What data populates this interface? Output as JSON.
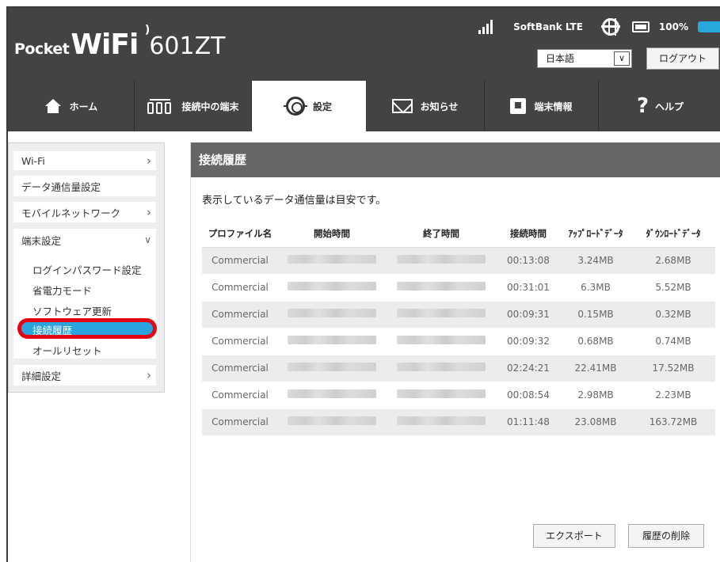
{
  "header": {
    "brand_pocket": "Pocket",
    "brand_wifi": "WiFi",
    "model": "601ZT",
    "carrier": "SoftBank  LTE",
    "battery": "100%",
    "language": "日本語",
    "logout_label": "ログアウト"
  },
  "nav": {
    "home": "ホーム",
    "connected_devices": "接続中の端末",
    "settings": "設定",
    "notices": "お知らせ",
    "device_info": "端末情報",
    "help": "ヘルプ"
  },
  "sidebar": {
    "wifi": "Wi-Fi",
    "data_usage": "データ通信量設定",
    "mobile_network": "モバイルネットワーク",
    "device_settings": "端末設定",
    "sub": {
      "login_password": "ログインパスワード設定",
      "power_save": "省電力モード",
      "software_update": "ソフトウェア更新",
      "connection_history": "接続履歴",
      "all_reset": "オールリセット"
    },
    "advanced": "詳細設定"
  },
  "main": {
    "title": "接続履歴",
    "notice": "表示しているデータ通信量は目安です。",
    "columns": [
      "プロファイル名",
      "開始時間",
      "終了時間",
      "接続時間",
      "ｱｯﾌﾟﾛｰﾄﾞﾃﾞｰﾀ",
      "ﾀﾞｳﾝﾛｰﾄﾞﾃﾞｰﾀ"
    ],
    "rows": [
      {
        "profile": "Commercial",
        "duration": "00:13:08",
        "upload": "3.24MB",
        "download": "2.68MB"
      },
      {
        "profile": "Commercial",
        "duration": "00:31:01",
        "upload": "6.3MB",
        "download": "5.52MB"
      },
      {
        "profile": "Commercial",
        "duration": "00:09:31",
        "upload": "0.15MB",
        "download": "0.32MB"
      },
      {
        "profile": "Commercial",
        "duration": "00:09:32",
        "upload": "0.68MB",
        "download": "0.74MB"
      },
      {
        "profile": "Commercial",
        "duration": "02:24:21",
        "upload": "22.41MB",
        "download": "17.52MB"
      },
      {
        "profile": "Commercial",
        "duration": "00:08:54",
        "upload": "2.98MB",
        "download": "2.23MB"
      },
      {
        "profile": "Commercial",
        "duration": "01:11:48",
        "upload": "23.08MB",
        "download": "163.72MB"
      }
    ],
    "export_label": "エクスポート",
    "delete_label": "履歴の削除"
  },
  "colors": {
    "header_bg": "#434343",
    "accent_blue": "#2aa3de",
    "highlight_red": "#e30613",
    "title_bar": "#666666"
  }
}
